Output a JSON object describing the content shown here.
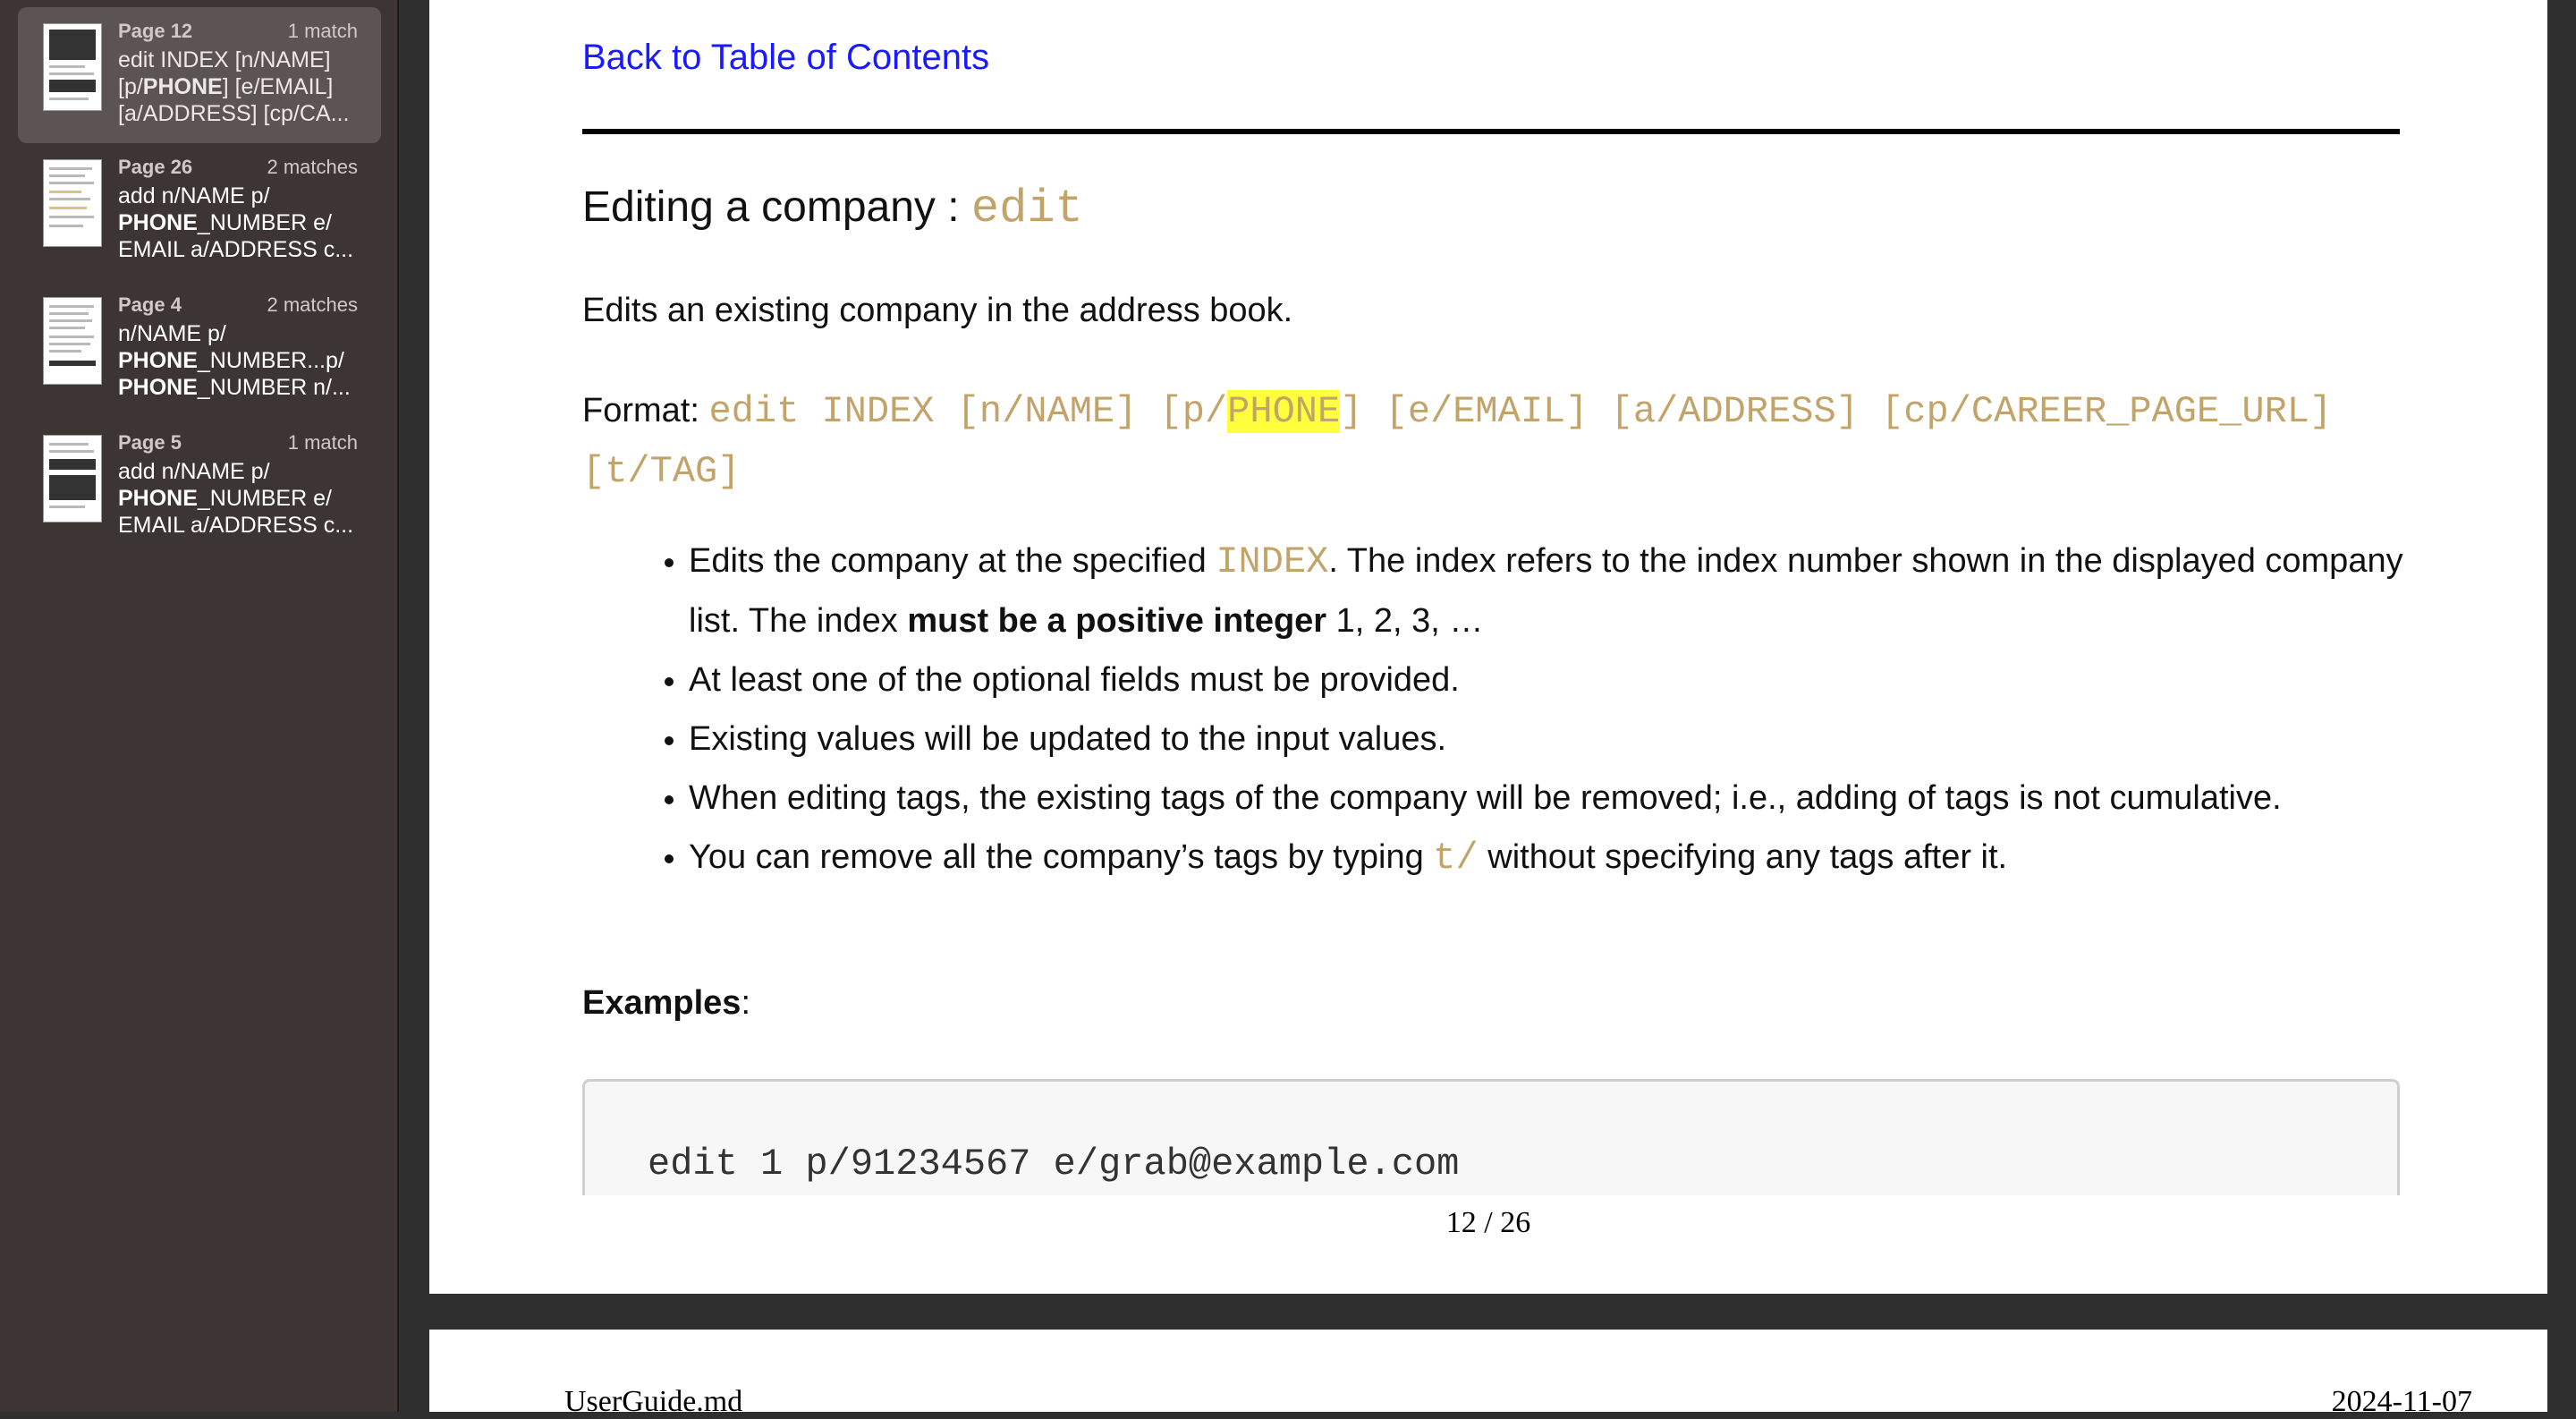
{
  "sidebar": {
    "results": [
      {
        "page": "Page 12",
        "count": "1 match",
        "text_pre": "edit INDEX [n/NAME]\n[p/",
        "text_bold": "PHONE",
        "text_post": "] [e/EMAIL]\n[a/ADDRESS] [cp/CA...",
        "selected": true
      },
      {
        "page": "Page 26",
        "count": "2 matches",
        "text_pre": "add n/NAME p/\n",
        "text_bold": "PHONE",
        "text_post": "_NUMBER e/\nEMAIL a/ADDRESS c...",
        "selected": false
      },
      {
        "page": "Page 4",
        "count": "2 matches",
        "text_pre": "n/NAME p/\n",
        "text_bold": "PHONE",
        "text_post": "_NUMBER...p/",
        "text_bold2": "PHONE",
        "text_post2": "_NUMBER n/...",
        "selected": false
      },
      {
        "page": "Page 5",
        "count": "1 match",
        "text_pre": "add n/NAME p/\n",
        "text_bold": "PHONE",
        "text_post": "_NUMBER e/\nEMAIL a/ADDRESS c...",
        "selected": false
      }
    ]
  },
  "document": {
    "back_link": "Back to Table of Contents",
    "heading_text": "Editing a company : ",
    "heading_code": "edit",
    "description": "Edits an existing company in the address book.",
    "format_label": "Format: ",
    "format_code_pre": "edit INDEX [n/NAME] [p/",
    "format_code_highlight": "PHONE",
    "format_code_post": "] [e/EMAIL] [a/ADDRESS] [cp/CAREER_PAGE_URL]",
    "format_code_line2": "[t/TAG]",
    "bullets": {
      "b1_pre": "Edits the company at the specified ",
      "b1_code": "INDEX",
      "b1_mid": ". The index refers to the index number shown in the displayed company list. The index ",
      "b1_bold": "must be a positive integer",
      "b1_post": " 1, 2, 3, …",
      "b2": "At least one of the optional fields must be provided.",
      "b3": "Existing values will be updated to the input values.",
      "b4": "When editing tags, the existing tags of the company will be removed; i.e., adding of tags is not cumulative.",
      "b5_pre": "You can remove all the company’s tags by typing ",
      "b5_code": "t/",
      "b5_post": " without specifying any tags after it."
    },
    "examples_label": "Examples",
    "examples_colon": ":",
    "example_code": "edit 1 p/91234567 e/grab@example.com",
    "page_number": "12 / 26",
    "footer_left": "UserGuide.md",
    "footer_right": "2024-11-07"
  },
  "colors": {
    "link": "#1a1aff",
    "code": "#c2a46b",
    "highlight": "#ffff3d",
    "sidebar_bg": "#3d3533"
  }
}
